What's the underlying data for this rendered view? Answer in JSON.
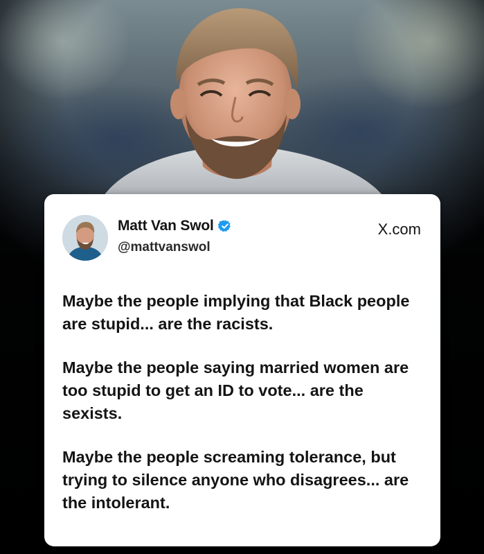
{
  "post": {
    "author_name": "Matt Van Swol",
    "handle": "@mattvanswol",
    "site": "X.com",
    "paragraphs": [
      "Maybe the people implying that Black people are stupid... are the racists.",
      "Maybe the people saying married women are too stupid to get an ID to vote... are the sexists.",
      "Maybe the people screaming tolerance, but trying to silence anyone who disagrees... are the intolerant."
    ]
  },
  "icons": {
    "verified": "verified-badge-icon",
    "avatar": "profile-photo"
  },
  "colors": {
    "verified_blue": "#1d9bf0",
    "card_bg": "#ffffff",
    "text": "#141414"
  }
}
